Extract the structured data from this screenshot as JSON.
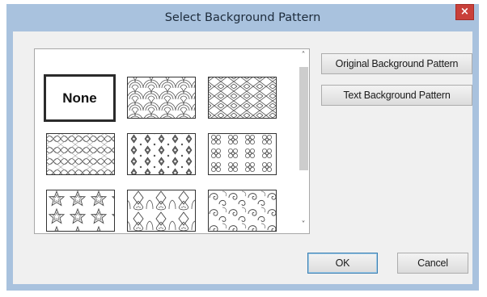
{
  "dialog": {
    "title": "Select Background Pattern",
    "close_glyph": "×"
  },
  "patterns": {
    "none_label": "None",
    "items": [
      "none",
      "fish-scale",
      "diamond-lattice",
      "wave-lattice",
      "floral-diamond",
      "knot-motif",
      "stars",
      "card-suits",
      "swirl"
    ],
    "selected": "None"
  },
  "scrollbar": {
    "up_glyph": "˄",
    "down_glyph": "˅"
  },
  "buttons": {
    "original_pattern": "Original Background Pattern",
    "text_pattern": "Text Background Pattern",
    "ok": "OK",
    "cancel": "Cancel"
  }
}
